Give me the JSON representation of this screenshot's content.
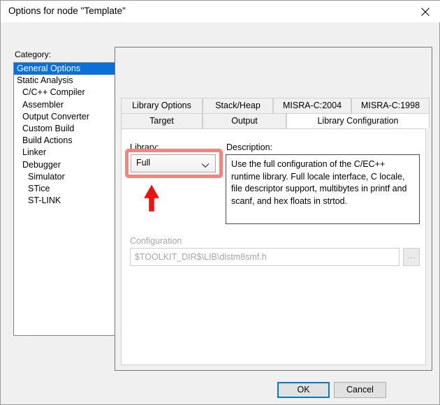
{
  "window": {
    "title": "Options for node \"Template\"",
    "close_icon": "close-icon"
  },
  "category": {
    "label": "Category:",
    "items": [
      {
        "label": "General Options",
        "indent": 0,
        "selected": true
      },
      {
        "label": "Static Analysis",
        "indent": 0,
        "selected": false
      },
      {
        "label": "C/C++ Compiler",
        "indent": 1,
        "selected": false
      },
      {
        "label": "Assembler",
        "indent": 1,
        "selected": false
      },
      {
        "label": "Output Converter",
        "indent": 1,
        "selected": false
      },
      {
        "label": "Custom Build",
        "indent": 1,
        "selected": false
      },
      {
        "label": "Build Actions",
        "indent": 1,
        "selected": false
      },
      {
        "label": "Linker",
        "indent": 1,
        "selected": false
      },
      {
        "label": "Debugger",
        "indent": 1,
        "selected": false
      },
      {
        "label": "Simulator",
        "indent": 2,
        "selected": false
      },
      {
        "label": "STice",
        "indent": 2,
        "selected": false
      },
      {
        "label": "ST-LINK",
        "indent": 2,
        "selected": false
      }
    ]
  },
  "tabs": {
    "row1": [
      {
        "label": "Library Options",
        "active": false
      },
      {
        "label": "Stack/Heap",
        "active": false
      },
      {
        "label": "MISRA-C:2004",
        "active": false
      },
      {
        "label": "MISRA-C:1998",
        "active": false
      }
    ],
    "row2": [
      {
        "label": "Target",
        "active": false
      },
      {
        "label": "Output",
        "active": false
      },
      {
        "label": "Library Configuration",
        "active": true
      }
    ]
  },
  "library": {
    "label": "Library:",
    "value": "Full",
    "chevron_icon": "chevron-down-icon",
    "highlight_color": "#f2867f",
    "cursor_color": "#ee1111"
  },
  "description": {
    "label": "Description:",
    "text": "Use the full configuration of the C/EC++ runtime library. Full locale interface, C locale, file descriptor support, multibytes in printf and scanf, and hex floats in strtod."
  },
  "configuration": {
    "label": "Configuration",
    "value": "$TOOLKIT_DIR$\\LIB\\dlstm8smf.h",
    "browse_label": "...",
    "disabled_color": "#a6a6a6"
  },
  "footer": {
    "ok_label": "OK",
    "cancel_label": "Cancel",
    "focus_color": "#0078d7"
  }
}
